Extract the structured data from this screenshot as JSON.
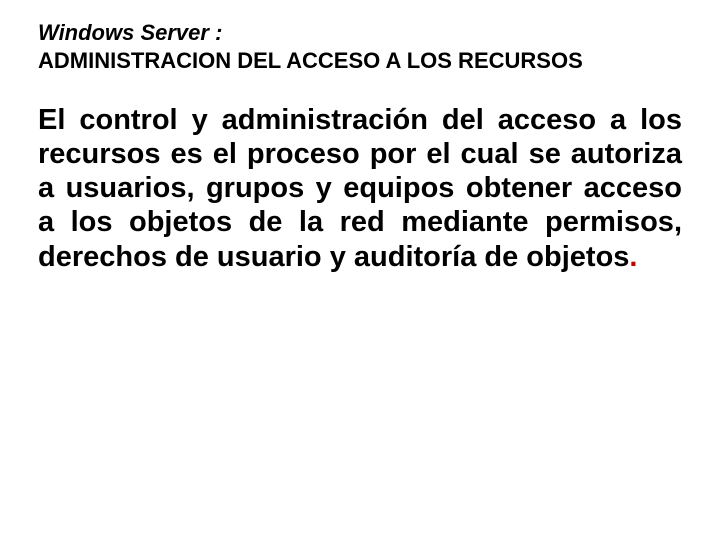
{
  "heading1": "Windows Server :",
  "heading2": "ADMINISTRACION DEL ACCESO A LOS RECURSOS",
  "body_main": "El control y administración del acceso a los recursos es el proceso por el cual se autoriza a usuarios, grupos y equipos obtener acceso a los objetos de la red mediante permisos, derechos de usuario y auditoría de objetos",
  "body_period": "."
}
